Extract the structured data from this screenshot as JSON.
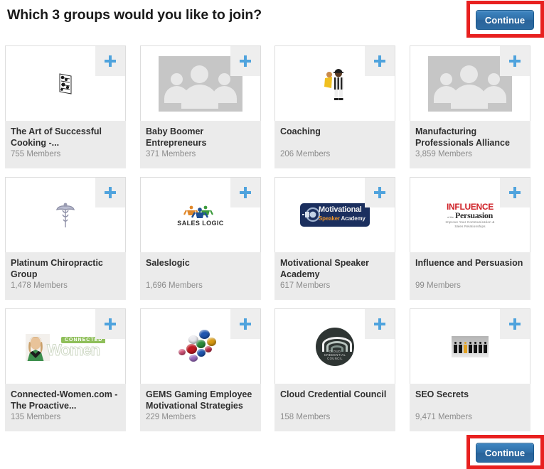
{
  "header": {
    "title": "Which 3 groups would you like to join?"
  },
  "buttons": {
    "continue_top": "Continue",
    "continue_bottom": "Continue"
  },
  "colors": {
    "accent_plus": "#4fa3dd",
    "button_blue": "#2f6fa8",
    "annotation_red": "#e8201f",
    "card_footer": "#ebebeb",
    "title_text": "#2f2f2f",
    "members_text": "#8c8c8c"
  },
  "icons": {
    "add": "plus-icon"
  },
  "groups": [
    {
      "name": "The Art of Successful Cooking -...",
      "members": "755 Members",
      "image": "cooking-sketch-image",
      "add_label": "plus-icon"
    },
    {
      "name": "Baby Boomer Entrepreneurs",
      "members": "371 Members",
      "image": "placeholder-group-avatar-image",
      "add_label": "plus-icon"
    },
    {
      "name": "Coaching",
      "members": "206 Members",
      "image": "coach-figure-image",
      "add_label": "plus-icon"
    },
    {
      "name": "Manufacturing Professionals Alliance",
      "members": "3,859 Members",
      "image": "placeholder-group-avatar-image",
      "add_label": "plus-icon"
    },
    {
      "name": "Platinum Chiropractic Group",
      "members": "1,478 Members",
      "image": "caduceus-logo-image",
      "add_label": "plus-icon"
    },
    {
      "name": "Saleslogic",
      "members": "1,696 Members",
      "image": "saleslogic-logo-image",
      "logo_text": "SALES LOGIC",
      "add_label": "plus-icon"
    },
    {
      "name": "Motivational Speaker Academy",
      "members": "617 Members",
      "image": "motivational-speaker-academy-logo-image",
      "logo_line1": "Motivational",
      "logo_line2a": "Speaker",
      "logo_line2b": "Academy",
      "add_label": "plus-icon"
    },
    {
      "name": "Influence and Persuasion",
      "members": "99 Members",
      "image": "influence-persuasion-logo-image",
      "logo_line1": "INFLUENCE",
      "logo_line2": "Persuasion",
      "logo_connector": "of the",
      "logo_tagline": "Improve Your Communication & Sales Relationships",
      "add_label": "plus-icon"
    },
    {
      "name": "Connected-Women.com - The Proactive...",
      "members": "135 Members",
      "image": "connected-women-logo-image",
      "logo_badge": "CONNECTED",
      "logo_word": "Women",
      "add_label": "plus-icon"
    },
    {
      "name": "GEMS Gaming Employee Motivational Strategies",
      "members": "229 Members",
      "image": "gemstones-logo-image",
      "add_label": "plus-icon"
    },
    {
      "name": "Cloud Credential Council",
      "members": "158 Members",
      "image": "cloud-credential-council-logo-image",
      "logo_line1": "CLOUD",
      "logo_line2": "CREDENTIAL",
      "logo_line3": "COUNCIL",
      "add_label": "plus-icon"
    },
    {
      "name": "SEO Secrets",
      "members": "9,471 Members",
      "image": "paper-figures-image",
      "add_label": "plus-icon"
    }
  ]
}
